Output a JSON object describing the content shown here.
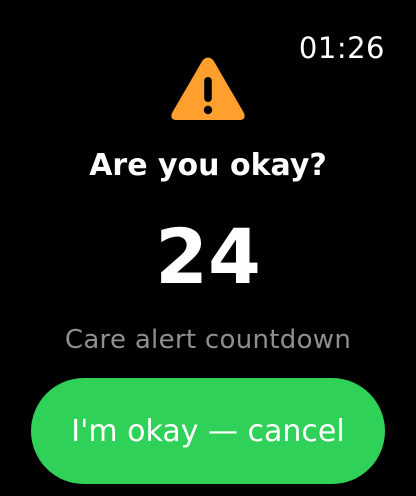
{
  "status_bar": {
    "time": "01:26"
  },
  "alert": {
    "icon": "warning-triangle-icon",
    "icon_color": "#ff9f2e",
    "title": "Are you okay?",
    "countdown": "24",
    "caption": "Care alert countdown"
  },
  "actions": {
    "cancel_label": "I'm okay — cancel",
    "cancel_color": "#30d158"
  }
}
